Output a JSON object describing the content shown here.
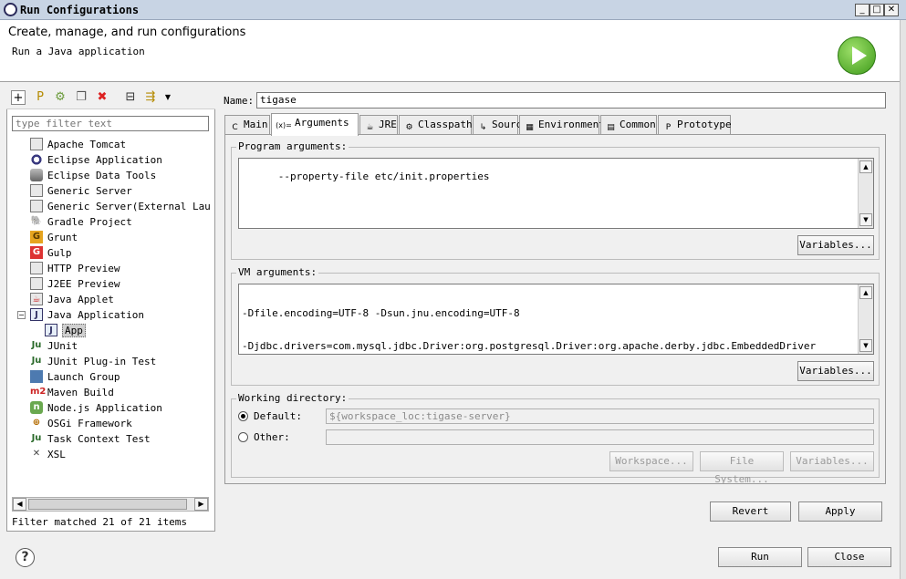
{
  "window": {
    "title": "Run Configurations"
  },
  "banner": {
    "heading": "Create, manage, and run configurations",
    "subheading": "Run a Java application"
  },
  "filter": {
    "placeholder": "type filter text"
  },
  "tree": [
    {
      "label": "Apache Tomcat",
      "icon": "document-icon"
    },
    {
      "label": "Eclipse Application",
      "icon": "eclipse-icon"
    },
    {
      "label": "Eclipse Data Tools",
      "icon": "database-icon"
    },
    {
      "label": "Generic Server",
      "icon": "document-icon"
    },
    {
      "label": "Generic Server(External Launch",
      "icon": "document-icon"
    },
    {
      "label": "Gradle Project",
      "icon": "gradle-icon"
    },
    {
      "label": "Grunt",
      "icon": "grunt-icon"
    },
    {
      "label": "Gulp",
      "icon": "gulp-icon"
    },
    {
      "label": "HTTP Preview",
      "icon": "document-icon"
    },
    {
      "label": "J2EE Preview",
      "icon": "document-icon"
    },
    {
      "label": "Java Applet",
      "icon": "applet-icon"
    },
    {
      "label": "Java Application",
      "icon": "java-app-icon"
    },
    {
      "label": "App",
      "icon": "java-app-icon"
    },
    {
      "label": "JUnit",
      "icon": "junit-icon"
    },
    {
      "label": "JUnit Plug-in Test",
      "icon": "junit-icon"
    },
    {
      "label": "Launch Group",
      "icon": "launch-group-icon"
    },
    {
      "label": "Maven Build",
      "icon": "maven-icon"
    },
    {
      "label": "Node.js Application",
      "icon": "nodejs-icon"
    },
    {
      "label": "OSGi Framework",
      "icon": "osgi-icon"
    },
    {
      "label": "Task Context Test",
      "icon": "junit-icon"
    },
    {
      "label": "XSL",
      "icon": "xsl-icon"
    }
  ],
  "filter_status": "Filter matched 21 of 21 items",
  "name": {
    "label": "Name:",
    "value": "tigase"
  },
  "tabs": [
    {
      "label": "Main",
      "icon": "main-icon"
    },
    {
      "label": "Arguments",
      "icon": "arguments-icon"
    },
    {
      "label": "JRE",
      "icon": "jre-icon"
    },
    {
      "label": "Classpath",
      "icon": "classpath-icon"
    },
    {
      "label": "Source",
      "icon": "source-icon"
    },
    {
      "label": "Environment",
      "icon": "environment-icon"
    },
    {
      "label": "Common",
      "icon": "common-icon"
    },
    {
      "label": "Prototype",
      "icon": "prototype-icon"
    }
  ],
  "program_args": {
    "label": "Program arguments:",
    "value": "--property-file etc/init.properties",
    "variables_button": "Variables..."
  },
  "vm_args": {
    "label": "VM arguments:",
    "line1": "-Dfile.encoding=UTF-8 -Dsun.jnu.encoding=UTF-8",
    "line2": "-Djdbc.drivers=com.mysql.jdbc.Driver:org.postgresql.Driver:org.apache.derby.jdbc.EmbeddedDriver",
    "variables_button": "Variables..."
  },
  "working_dir": {
    "label": "Working directory:",
    "default_label": "Default:",
    "default_value": "${workspace_loc:tigase-server}",
    "other_label": "Other:",
    "other_value": "",
    "workspace_button": "Workspace...",
    "filesystem_button": "File System...",
    "variables_button": "Variables..."
  },
  "buttons": {
    "revert": "Revert",
    "apply": "Apply",
    "run": "Run",
    "close": "Close"
  }
}
